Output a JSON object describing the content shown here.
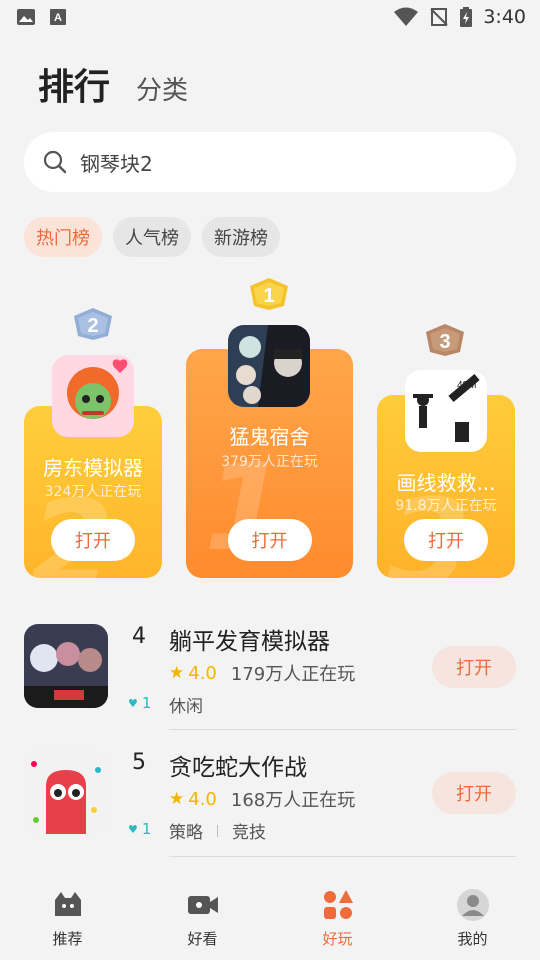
{
  "status_bar": {
    "time": "3:40",
    "left_icons": [
      "image-icon",
      "a-notification-icon"
    ],
    "right_icons": [
      "wifi-icon",
      "no-signal-icon",
      "battery-charging-icon"
    ]
  },
  "header": {
    "title": "排行",
    "subtitle": "分类"
  },
  "search": {
    "icon": "search-icon",
    "text": "钢琴块2"
  },
  "chips": [
    {
      "label": "热门榜",
      "active": true
    },
    {
      "label": "人气榜",
      "active": false
    },
    {
      "label": "新游榜",
      "active": false
    }
  ],
  "podium": {
    "first": {
      "rank": "1",
      "name": "猛鬼宿舍",
      "players": "379万人正在玩",
      "button": "打开"
    },
    "second": {
      "rank": "2",
      "name": "房东模拟器",
      "players": "324万人正在玩",
      "button": "打开"
    },
    "third": {
      "rank": "3",
      "name": "画线救救...",
      "players": "91.8万人正在玩",
      "button": "打开"
    }
  },
  "list": [
    {
      "rank": "4",
      "name": "躺平发育模拟器",
      "rating": "4.0",
      "players": "179万人正在玩",
      "tags": [
        "休闲"
      ],
      "trend": "1",
      "button": "打开"
    },
    {
      "rank": "5",
      "name": "贪吃蛇大作战",
      "rating": "4.0",
      "players": "168万人正在玩",
      "tags": [
        "策略",
        "竞技"
      ],
      "trend": "1",
      "button": "打开"
    }
  ],
  "bottom_nav": [
    {
      "label": "推荐",
      "icon": "recommend-icon",
      "active": false
    },
    {
      "label": "好看",
      "icon": "video-icon",
      "active": false
    },
    {
      "label": "好玩",
      "icon": "games-icon",
      "active": true
    },
    {
      "label": "我的",
      "icon": "profile-icon",
      "active": false
    }
  ],
  "colors": {
    "accent": "#ee6b3b",
    "gold": "#ff8b2e",
    "yellow": "#ffb52a"
  }
}
